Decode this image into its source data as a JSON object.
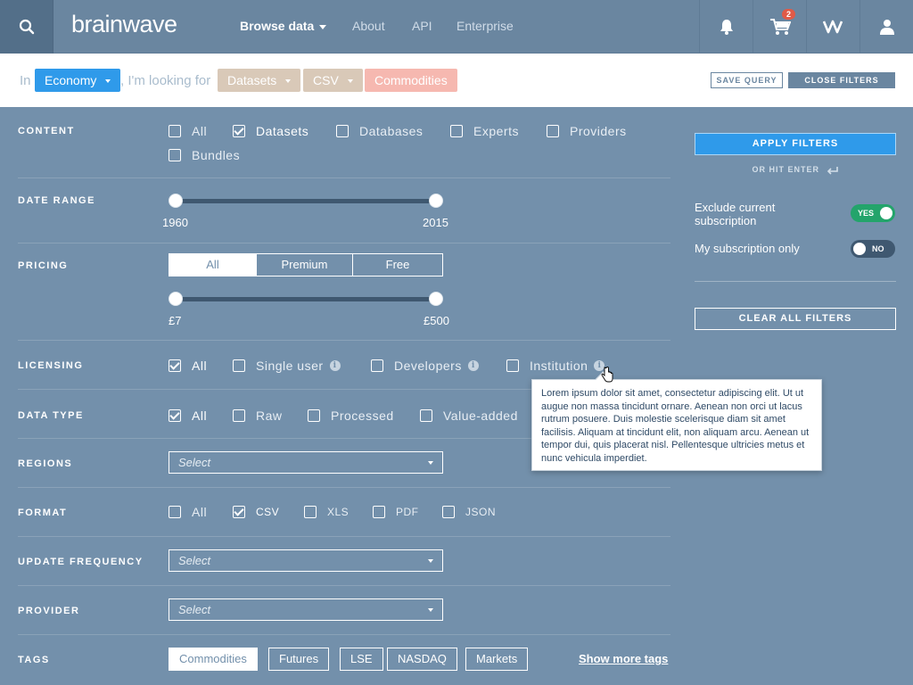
{
  "nav": {
    "logo": "brainwave",
    "links": [
      "Browse data",
      "About",
      "API",
      "Enterprise"
    ],
    "cart_count": "2"
  },
  "query": {
    "prefix": "In",
    "category": "Economy",
    "middle": ", I'm looking for",
    "filters": [
      "Datasets",
      "CSV",
      "Commodities"
    ],
    "save_label": "SAVE QUERY",
    "close_label": "CLOSE FILTERS"
  },
  "content": {
    "label": "CONTENT",
    "options": [
      "All",
      "Datasets",
      "Databases",
      "Experts",
      "Providers",
      "Bundles"
    ],
    "checked": [
      "Datasets"
    ]
  },
  "date_range": {
    "label": "DATE RANGE",
    "min": "1960",
    "max": "2015"
  },
  "pricing": {
    "label": "PRICING",
    "segments": [
      "All",
      "Premium",
      "Free"
    ],
    "selected": "All",
    "min": "£7",
    "max": "£500"
  },
  "licensing": {
    "label": "LICENSING",
    "options": [
      "All",
      "Single user",
      "Developers",
      "Institution"
    ],
    "checked": [
      "All"
    ]
  },
  "data_type": {
    "label": "DATA TYPE",
    "options": [
      "All",
      "Raw",
      "Processed",
      "Value-added"
    ],
    "checked": [
      "All"
    ]
  },
  "regions": {
    "label": "REGIONS",
    "placeholder": "Select"
  },
  "format": {
    "label": "FORMAT",
    "options": [
      "All",
      "CSV",
      "XLS",
      "PDF",
      "JSON"
    ],
    "checked": [
      "CSV"
    ]
  },
  "update_frequency": {
    "label": "UPDATE FREQUENCY",
    "placeholder": "Select"
  },
  "provider": {
    "label": "PROVIDER",
    "placeholder": "Select"
  },
  "tags": {
    "label": "TAGS",
    "items": [
      "Commodities",
      "Futures",
      "LSE",
      "NASDAQ",
      "Markets"
    ],
    "active": "Commodities",
    "more_label": "Show more tags"
  },
  "panel": {
    "apply_label": "APPLY FILTERS",
    "hint": "OR HIT ENTER",
    "exclude_label": "Exclude current subscription",
    "exclude_state": "YES",
    "mysub_label": "My subscription only",
    "mysub_state": "NO",
    "clear_label": "CLEAR ALL FILTERS"
  },
  "tooltip": {
    "text": "Lorem ipsum dolor sit amet, consectetur adipiscing elit. Ut ut augue non massa tincidunt ornare. Aenean non orci ut lacus rutrum posuere. Duis molestie scelerisque diam sit amet facilisis. Aliquam at tincidunt elit, non aliquam arcu. Aenean ut tempor dui, quis placerat nisl. Pellentesque ultricies metus et nunc vehicula imperdiet."
  },
  "colors": {
    "accent": "#2f9aea",
    "background": "#7390ab",
    "success": "#23a46b",
    "tag_pill": "#d9c9b8",
    "highlight_pill": "#f6b8b0"
  }
}
